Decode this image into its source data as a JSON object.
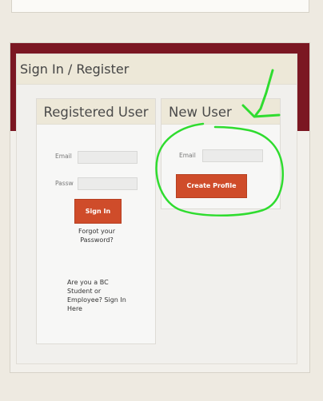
{
  "panel": {
    "title": "Sign In / Register"
  },
  "registered": {
    "title": "Registered User",
    "email_label": "Email",
    "email_value": "",
    "password_label": "Passw",
    "password_value": "",
    "signin_label": "Sign In",
    "forgot_line1": "Forgot your",
    "forgot_line2": "Password?",
    "bc_line1": "Are you a BC",
    "bc_line2": "Student or",
    "bc_line3": "Employee? Sign In",
    "bc_line4": "Here"
  },
  "new_user": {
    "title": "New User",
    "email_label": "Email",
    "email_value": "",
    "create_label": "Create Profile"
  },
  "colors": {
    "header_band": "#7b1722",
    "button": "#cf4c2a",
    "annotation": "#2fdc2f"
  },
  "icons": [
    "annotation-arrow-icon",
    "annotation-circle-icon"
  ]
}
